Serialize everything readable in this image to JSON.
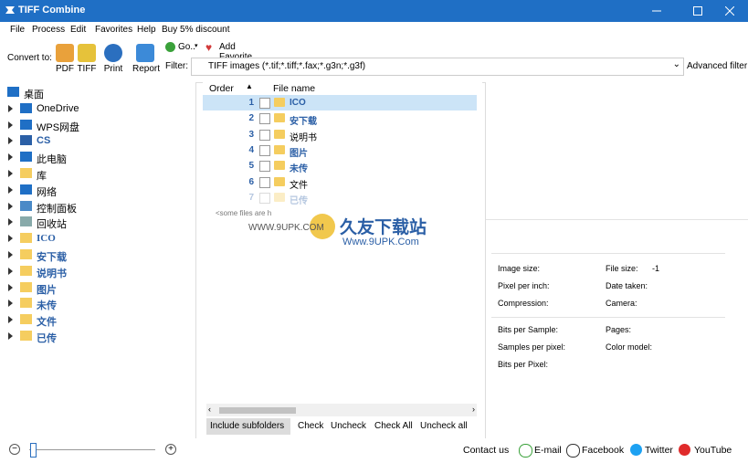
{
  "window": {
    "title": "TIFF Combine"
  },
  "menu": [
    "File",
    "Process",
    "Edit",
    "Favorites",
    "Help",
    "Buy 5% discount"
  ],
  "toolbar": {
    "convert_to_label": "Convert to:",
    "pdf_label": "PDF",
    "tiff_label": "TIFF",
    "print_label": "Print",
    "report_label": "Report",
    "go_label": "Go..",
    "add_favorite_label": "Add Favorite",
    "filter_label": "Filter:",
    "filter_value": "TIFF images (*.tif;*.tiff;*.fax;*.g3n;*.g3f)",
    "advanced_filter_label": "Advanced filter"
  },
  "tree": [
    {
      "label": "桌面",
      "icon": "desktop-icon",
      "color": "#1f6fc5"
    },
    {
      "label": "OneDrive",
      "icon": "cloud-icon",
      "color": "#1f6fc5"
    },
    {
      "label": "WPS网盘",
      "icon": "cloud-outline-icon",
      "color": "#1f6fc5"
    },
    {
      "label": "CS",
      "icon": "user-icon",
      "color": "#2b5fa6"
    },
    {
      "label": "此电脑",
      "icon": "computer-icon",
      "color": "#1f6fc5"
    },
    {
      "label": "库",
      "icon": "library-icon",
      "color": "#f5cd5f"
    },
    {
      "label": "网络",
      "icon": "network-icon",
      "color": "#1f6fc5"
    },
    {
      "label": "控制面板",
      "icon": "control-panel-icon",
      "color": "#4a8ac7"
    },
    {
      "label": "回收站",
      "icon": "recycle-bin-icon",
      "color": "#8aa"
    },
    {
      "label": "ICO",
      "icon": "folder-icon",
      "color": "#f5cd5f"
    },
    {
      "label": "安下载",
      "icon": "folder-icon",
      "color": "#f5cd5f"
    },
    {
      "label": "说明书",
      "icon": "folder-icon",
      "color": "#f5cd5f"
    },
    {
      "label": "图片",
      "icon": "folder-icon",
      "color": "#f5cd5f"
    },
    {
      "label": "未传",
      "icon": "folder-icon",
      "color": "#f5cd5f"
    },
    {
      "label": "文件",
      "icon": "folder-icon",
      "color": "#f5cd5f"
    },
    {
      "label": "已传",
      "icon": "folder-icon",
      "color": "#f5cd5f"
    }
  ],
  "file_list": {
    "col_order": "Order",
    "col_filename": "File name",
    "rows": [
      {
        "order": "1",
        "name": "ICO",
        "selected": true
      },
      {
        "order": "2",
        "name": "安下载",
        "selected": false
      },
      {
        "order": "3",
        "name": "说明书",
        "selected": false
      },
      {
        "order": "4",
        "name": "图片",
        "selected": false
      },
      {
        "order": "5",
        "name": "未传",
        "selected": false
      },
      {
        "order": "6",
        "name": "文件",
        "selected": false
      },
      {
        "order": "7",
        "name": "已传",
        "selected": false
      }
    ],
    "note": "<some files are h",
    "buttons": {
      "include_subfolders": "Include subfolders",
      "check": "Check",
      "uncheck": "Uncheck",
      "check_all": "Check All",
      "uncheck_all": "Uncheck all"
    }
  },
  "properties": {
    "image_size": "Image size:",
    "file_size": "File size:",
    "file_size_value": "-1",
    "pixel_per_inch": "Pixel per inch:",
    "date_taken": "Date taken:",
    "compression": "Compression:",
    "camera": "Camera:",
    "bits_per_sample": "Bits per Sample:",
    "pages": "Pages:",
    "samples_per_pixel": "Samples per pixel:",
    "color_model": "Color model:",
    "bits_per_pixel": "Bits per Pixel:"
  },
  "watermark": {
    "line1": "久友下载站",
    "line2": "Www.9UPK.Com",
    "small": "WWW.9UPK.COM"
  },
  "status": {
    "contact_label": "Contact us",
    "email_label": "E-mail",
    "facebook_label": "Facebook",
    "twitter_label": "Twitter",
    "youtube_label": "YouTube"
  }
}
